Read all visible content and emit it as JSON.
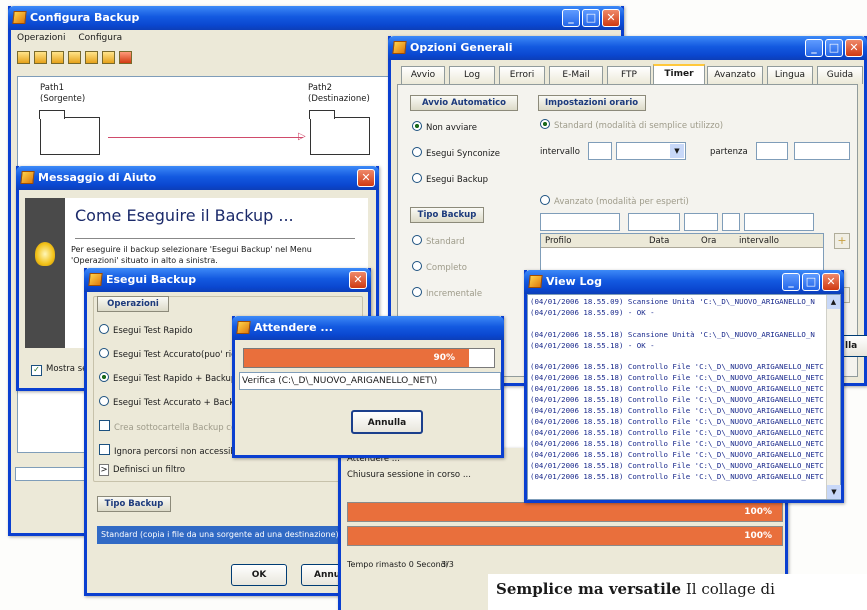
{
  "configura": {
    "title": "Configura Backup",
    "menu": [
      "Operazioni",
      "Configura"
    ],
    "path1_label": "Path1",
    "path1_role": "(Sorgente)",
    "path2_label": "Path2",
    "path2_role": "(Destinazione)"
  },
  "opzioni": {
    "title": "Opzioni Generali",
    "tabs": [
      "Avvio",
      "Log",
      "Errori",
      "E-Mail",
      "FTP",
      "Timer",
      "Avanzato",
      "Lingua",
      "Guida"
    ],
    "active_tab": "Timer",
    "avvio_header": "Avvio Automatico",
    "avvio_options": [
      "Non avviare",
      "Esegui Synconize",
      "Esegui Backup"
    ],
    "tipo_header": "Tipo Backup",
    "tipo_options": [
      "Standard",
      "Completo",
      "Incrementale"
    ],
    "orario_header": "Impostazioni orario",
    "orario_simple": "Standard (modalità di semplice utilizzo)",
    "intervallo_label": "intervallo",
    "partenza_label": "partenza",
    "orario_expert": "Avanzato (modalità per esperti)",
    "table_headers": [
      "Profilo",
      "Data",
      "Ora",
      "intervallo"
    ],
    "footer_fragment": "lla"
  },
  "aiuto": {
    "title": "Messaggio di Aiuto",
    "heading": "Come Eseguire il Backup ...",
    "text_line1": "Per eseguire il backup selezionare 'Esegui Backup' nel Menu",
    "text_line2": "'Operazioni' situato in alto a sinistra.",
    "show_checkbox": "Mostra se"
  },
  "esegui": {
    "title": "Esegui Backup",
    "ops_header": "Operazioni",
    "options": [
      "Esegui Test Rapido",
      "Esegui Test Accurato(puo' richi",
      "Esegui Test Rapido + Backup",
      "Esegui Test Accurato + Backup"
    ],
    "selected_option": "Esegui Test Rapido + Backup",
    "create_folder": "Crea sottocartella Backup con",
    "ignore_paths": "Ignora percorsi non accessibili",
    "filter": "Definisci un filtro",
    "tipo_header": "Tipo Backup",
    "tipo_value": "Standard (copia i file da una sorgente ad una destinazione)",
    "ok_label": "OK",
    "annulla_fragment": "Annu"
  },
  "attendere": {
    "title": "Attendere ...",
    "percent": "90%",
    "progress": 0.9,
    "path": "Verifica (C:\\_D\\_NUOVO_ARIGANELLO_NET\\)",
    "cancel_label": "Annulla"
  },
  "progress_bg": {
    "status1": "Attendere ...",
    "status2": "Chiusura sessione in corso ...",
    "bar1": "100%",
    "bar2": "100%",
    "time_left": "Tempo rimasto 0 Secondi",
    "fragment": "3/3"
  },
  "viewlog": {
    "title": "View Log",
    "lines": [
      "(04/01/2006 18.55.09) Scansione Unità 'C:\\_D\\_NUOVO_ARIGANELLO_N",
      "(04/01/2006 18.55.09) - OK -",
      "",
      "(04/01/2006 18.55.18) Scansione Unità 'C:\\_D\\_NUOVO_ARIGANELLO_N",
      "(04/01/2006 18.55.18) - OK -",
      "",
      "(04/01/2006 18.55.18) Controllo File 'C:\\_D\\_NUOVO_ARIGANELLO_NETC",
      "(04/01/2006 18.55.18) Controllo File 'C:\\_D\\_NUOVO_ARIGANELLO_NETC",
      "(04/01/2006 18.55.18) Controllo File 'C:\\_D\\_NUOVO_ARIGANELLO_NETC",
      "(04/01/2006 18.55.18) Controllo File 'C:\\_D\\_NUOVO_ARIGANELLO_NETC",
      "(04/01/2006 18.55.18) Controllo File 'C:\\_D\\_NUOVO_ARIGANELLO_NETC",
      "(04/01/2006 18.55.18) Controllo File 'C:\\_D\\_NUOVO_ARIGANELLO_NETC",
      "(04/01/2006 18.55.18) Controllo File 'C:\\_D\\_NUOVO_ARIGANELLO_NETC",
      "(04/01/2006 18.55.18) Controllo File 'C:\\_D\\_NUOVO_ARIGANELLO_NETC",
      "(04/01/2006 18.55.18) Controllo File 'C:\\_D\\_NUOVO_ARIGANELLO_NETC",
      "(04/01/2006 18.55.18) Controllo File 'C:\\_D\\_NUOVO_ARIGANELLO_NETC",
      "(04/01/2006 18.55.18) Controllo File 'C:\\_D\\_NUOVO_ARIGANELLO_NETC"
    ]
  },
  "caption": {
    "bold": "Semplice ma versatile",
    "text": "Il collage di"
  },
  "colors": {
    "titlebar": "#0a47d0",
    "progress": "#e96f3c",
    "window_bg": "#ece9d8"
  }
}
